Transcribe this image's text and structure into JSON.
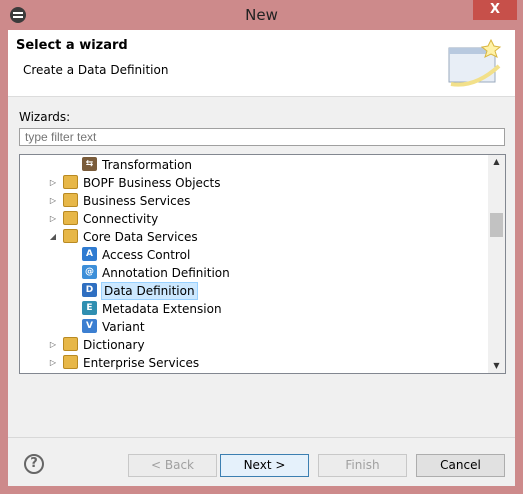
{
  "window": {
    "title": "New",
    "close_label": "X"
  },
  "header": {
    "title": "Select a wizard",
    "description": "Create a Data Definition"
  },
  "wizards_label": "Wizards:",
  "filter": {
    "placeholder": "type filter text",
    "value": ""
  },
  "tree": [
    {
      "label": "Transformation",
      "icon": "transformation-icon",
      "level": 2,
      "expander": ""
    },
    {
      "label": "BOPF Business Objects",
      "icon": "folder-icon",
      "level": 1,
      "expander": "▷"
    },
    {
      "label": "Business Services",
      "icon": "folder-icon",
      "level": 1,
      "expander": "▷"
    },
    {
      "label": "Connectivity",
      "icon": "folder-icon",
      "level": 1,
      "expander": "▷"
    },
    {
      "label": "Core Data Services",
      "icon": "folder-icon",
      "level": 1,
      "expander": "◢"
    },
    {
      "label": "Access Control",
      "icon": "access-control-icon",
      "level": 2,
      "expander": ""
    },
    {
      "label": "Annotation Definition",
      "icon": "annotation-definition-icon",
      "level": 2,
      "expander": ""
    },
    {
      "label": "Data Definition",
      "icon": "data-definition-icon",
      "level": 2,
      "expander": "",
      "selected": true
    },
    {
      "label": "Metadata Extension",
      "icon": "metadata-extension-icon",
      "level": 2,
      "expander": ""
    },
    {
      "label": "Variant",
      "icon": "variant-icon",
      "level": 2,
      "expander": ""
    },
    {
      "label": "Dictionary",
      "icon": "folder-icon",
      "level": 1,
      "expander": "▷"
    },
    {
      "label": "Enterprise Services",
      "icon": "folder-icon",
      "level": 1,
      "expander": "▷"
    }
  ],
  "buttons": {
    "back": "< Back",
    "next": "Next >",
    "finish": "Finish",
    "cancel": "Cancel"
  },
  "help_glyph": "?",
  "colors": {
    "selection": "#cce8ff",
    "title_bar": "#cd8a8b",
    "close_button": "#c7504a"
  }
}
